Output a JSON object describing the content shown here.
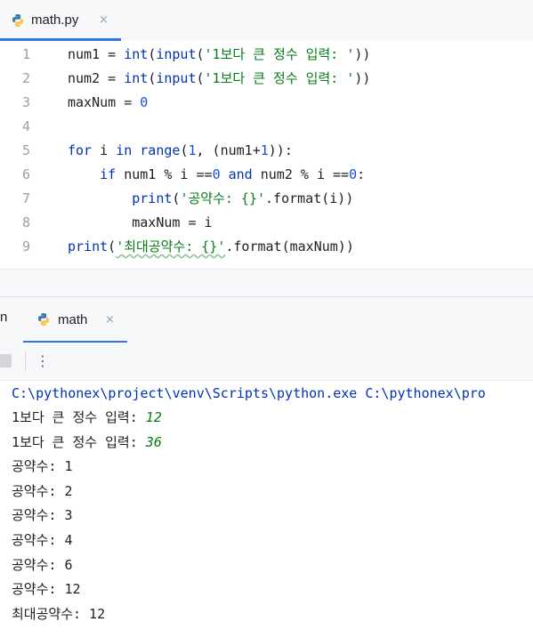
{
  "editor_tab": {
    "label": "math.py",
    "close": "×"
  },
  "editor": {
    "line_numbers": [
      "1",
      "2",
      "3",
      "4",
      "5",
      "6",
      "7",
      "8",
      "9"
    ],
    "lines": [
      [
        {
          "t": "num1 = ",
          "c": "fn"
        },
        {
          "t": "int",
          "c": "kw"
        },
        {
          "t": "(",
          "c": "fn"
        },
        {
          "t": "input",
          "c": "kw"
        },
        {
          "t": "(",
          "c": "fn"
        },
        {
          "t": "'1보다 큰 정수 입력: '",
          "c": "str"
        },
        {
          "t": "))",
          "c": "fn"
        }
      ],
      [
        {
          "t": "num2 = ",
          "c": "fn"
        },
        {
          "t": "int",
          "c": "kw"
        },
        {
          "t": "(",
          "c": "fn"
        },
        {
          "t": "input",
          "c": "kw"
        },
        {
          "t": "(",
          "c": "fn"
        },
        {
          "t": "'1보다 큰 정수 입력: '",
          "c": "str"
        },
        {
          "t": "))",
          "c": "fn"
        }
      ],
      [
        {
          "t": "maxNum = ",
          "c": "fn"
        },
        {
          "t": "0",
          "c": "num"
        }
      ],
      [],
      [
        {
          "t": "for",
          "c": "kw"
        },
        {
          "t": " i ",
          "c": "fn"
        },
        {
          "t": "in",
          "c": "kw"
        },
        {
          "t": " ",
          "c": "fn"
        },
        {
          "t": "range",
          "c": "kw"
        },
        {
          "t": "(",
          "c": "fn"
        },
        {
          "t": "1",
          "c": "num"
        },
        {
          "t": ", (num1+",
          "c": "fn"
        },
        {
          "t": "1",
          "c": "num"
        },
        {
          "t": ")):",
          "c": "fn"
        }
      ],
      [
        {
          "t": "    ",
          "c": "fn"
        },
        {
          "t": "if",
          "c": "kw"
        },
        {
          "t": " num1 % i ==",
          "c": "fn"
        },
        {
          "t": "0",
          "c": "num"
        },
        {
          "t": " ",
          "c": "fn"
        },
        {
          "t": "and",
          "c": "kw"
        },
        {
          "t": " num2 % i ==",
          "c": "fn"
        },
        {
          "t": "0",
          "c": "num"
        },
        {
          "t": ":",
          "c": "fn"
        }
      ],
      [
        {
          "t": "        ",
          "c": "fn"
        },
        {
          "t": "print",
          "c": "kw"
        },
        {
          "t": "(",
          "c": "fn"
        },
        {
          "t": "'공약수: {}'",
          "c": "str"
        },
        {
          "t": ".format(i))",
          "c": "fn"
        }
      ],
      [
        {
          "t": "        maxNum = i",
          "c": "fn"
        }
      ],
      [
        {
          "t": "print",
          "c": "kw"
        },
        {
          "t": "(",
          "c": "fn"
        },
        {
          "t": "'최대공약수: {}'",
          "c": "str squig"
        },
        {
          "t": ".format(maxNum))",
          "c": "fn"
        }
      ]
    ]
  },
  "run_panel": {
    "left_clip_text": "n",
    "tab_label": "math",
    "tab_close": "×",
    "more_label": "⋮"
  },
  "console": {
    "command": "C:\\pythonex\\project\\venv\\Scripts\\python.exe C:\\pythonex\\pro",
    "lines": [
      {
        "prompt": "1보다 큰 정수 입력: ",
        "input": "12"
      },
      {
        "prompt": "1보다 큰 정수 입력: ",
        "input": "36"
      },
      {
        "prompt": "공약수: 1",
        "input": ""
      },
      {
        "prompt": "공약수: 2",
        "input": ""
      },
      {
        "prompt": "공약수: 3",
        "input": ""
      },
      {
        "prompt": "공약수: 4",
        "input": ""
      },
      {
        "prompt": "공약수: 6",
        "input": ""
      },
      {
        "prompt": "공약수: 12",
        "input": ""
      },
      {
        "prompt": "최대공약수: 12",
        "input": ""
      }
    ]
  },
  "colors": {
    "accent": "#3574f0",
    "keyword": "#0033b3",
    "string": "#067d17",
    "number": "#1750eb"
  }
}
